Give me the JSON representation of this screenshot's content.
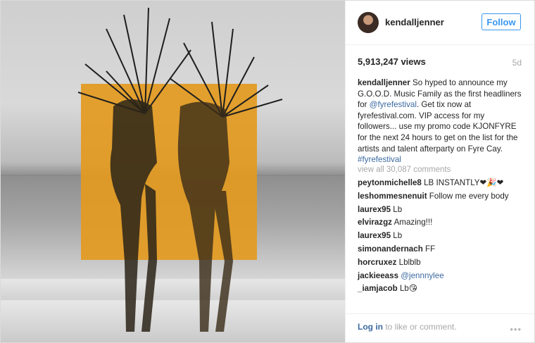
{
  "post": {
    "username": "kendalljenner",
    "follow_label": "Follow",
    "views": "5,913,247 views",
    "age": "5d",
    "caption": {
      "user": "kendalljenner",
      "text_1": " So hyped to announce my G.O.O.D. Music Family as the first headliners for ",
      "mention": "@fyrefestival",
      "text_2": ". Get tix now at fyrefestival.com. VIP access for my followers... use my promo code KJONFYRE for the next 24 hours to get on the list for the artists and talent afterparty on Fyre Cay. ",
      "hashtag": "#fyrefestival"
    },
    "view_all": "view all 30,087 comments",
    "comments": [
      {
        "user": "peytonmichelle8",
        "text": " LB INSTANTLY❤🎉❤"
      },
      {
        "user": "leshommesnenuit",
        "text": " Follow me every body"
      },
      {
        "user": "laurex95",
        "text": " Lb"
      },
      {
        "user": "elvirazgz",
        "text": " Amazing!!!"
      },
      {
        "user": "laurex95",
        "text": " Lb"
      },
      {
        "user": "simonandernach",
        "text": " FF"
      },
      {
        "user": "horcruxez",
        "text": " Lblblb"
      },
      {
        "user": "jackieeass",
        "text": " @jennnylee"
      },
      {
        "user": "_iamjacob",
        "text": " Lb😘"
      }
    ],
    "footer": {
      "login_link": "Log in",
      "login_text": " to like or comment.",
      "more_icon": "more-dots-icon"
    }
  },
  "colors": {
    "accent": "#3897f0",
    "link": "#3b6aa0",
    "overlay": "#e39a1f"
  }
}
